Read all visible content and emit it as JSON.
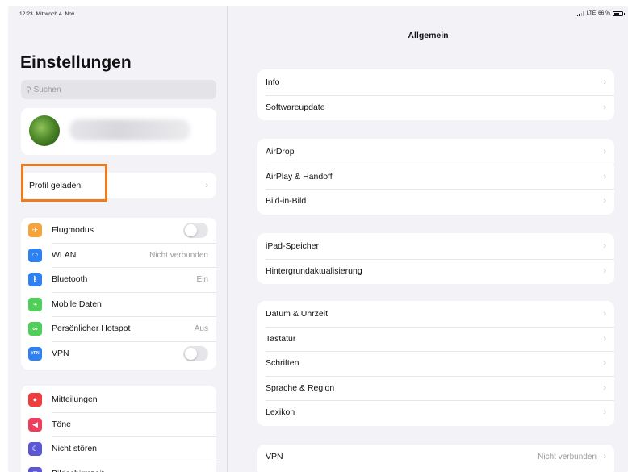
{
  "status": {
    "time": "12:23",
    "date": "Mittwoch 4. Nov.",
    "network": "LTE",
    "battery": "66 %"
  },
  "sidebar": {
    "title": "Einstellungen",
    "search_placeholder": "Suchen",
    "profile_loaded": "Profil geladen",
    "network_items": [
      {
        "label": "Flugmodus",
        "icon": "airplane-icon",
        "color": "#f7a33b",
        "control": "toggle",
        "value": ""
      },
      {
        "label": "WLAN",
        "icon": "wifi-icon",
        "color": "#2f80f0",
        "control": "value",
        "value": "Nicht verbunden"
      },
      {
        "label": "Bluetooth",
        "icon": "bluetooth-icon",
        "color": "#2f80f0",
        "control": "value",
        "value": "Ein"
      },
      {
        "label": "Mobile Daten",
        "icon": "antenna-icon",
        "color": "#4fcf5a",
        "control": "none",
        "value": ""
      },
      {
        "label": "Persönlicher Hotspot",
        "icon": "hotspot-icon",
        "color": "#4fcf5a",
        "control": "value",
        "value": "Aus"
      },
      {
        "label": "VPN",
        "icon": "vpn-icon",
        "color": "#2f80f0",
        "control": "toggle",
        "value": ""
      }
    ],
    "notif_items": [
      {
        "label": "Mitteilungen",
        "icon": "notifications-icon",
        "color": "#ef3d3d"
      },
      {
        "label": "Töne",
        "icon": "sound-icon",
        "color": "#ef3d5d"
      },
      {
        "label": "Nicht stören",
        "icon": "moon-icon",
        "color": "#5b57d4"
      },
      {
        "label": "Bildschirmzeit",
        "icon": "hourglass-icon",
        "color": "#5b57d4"
      }
    ]
  },
  "detail": {
    "title": "Allgemein",
    "groups": [
      [
        "Info",
        "Softwareupdate"
      ],
      [
        "AirDrop",
        "AirPlay & Handoff",
        "Bild-in-Bild"
      ],
      [
        "iPad-Speicher",
        "Hintergrundaktualisierung"
      ],
      [
        "Datum & Uhrzeit",
        "Tastatur",
        "Schriften",
        "Sprache & Region",
        "Lexikon"
      ]
    ],
    "vpn": {
      "label": "VPN",
      "value": "Nicht verbunden"
    }
  }
}
